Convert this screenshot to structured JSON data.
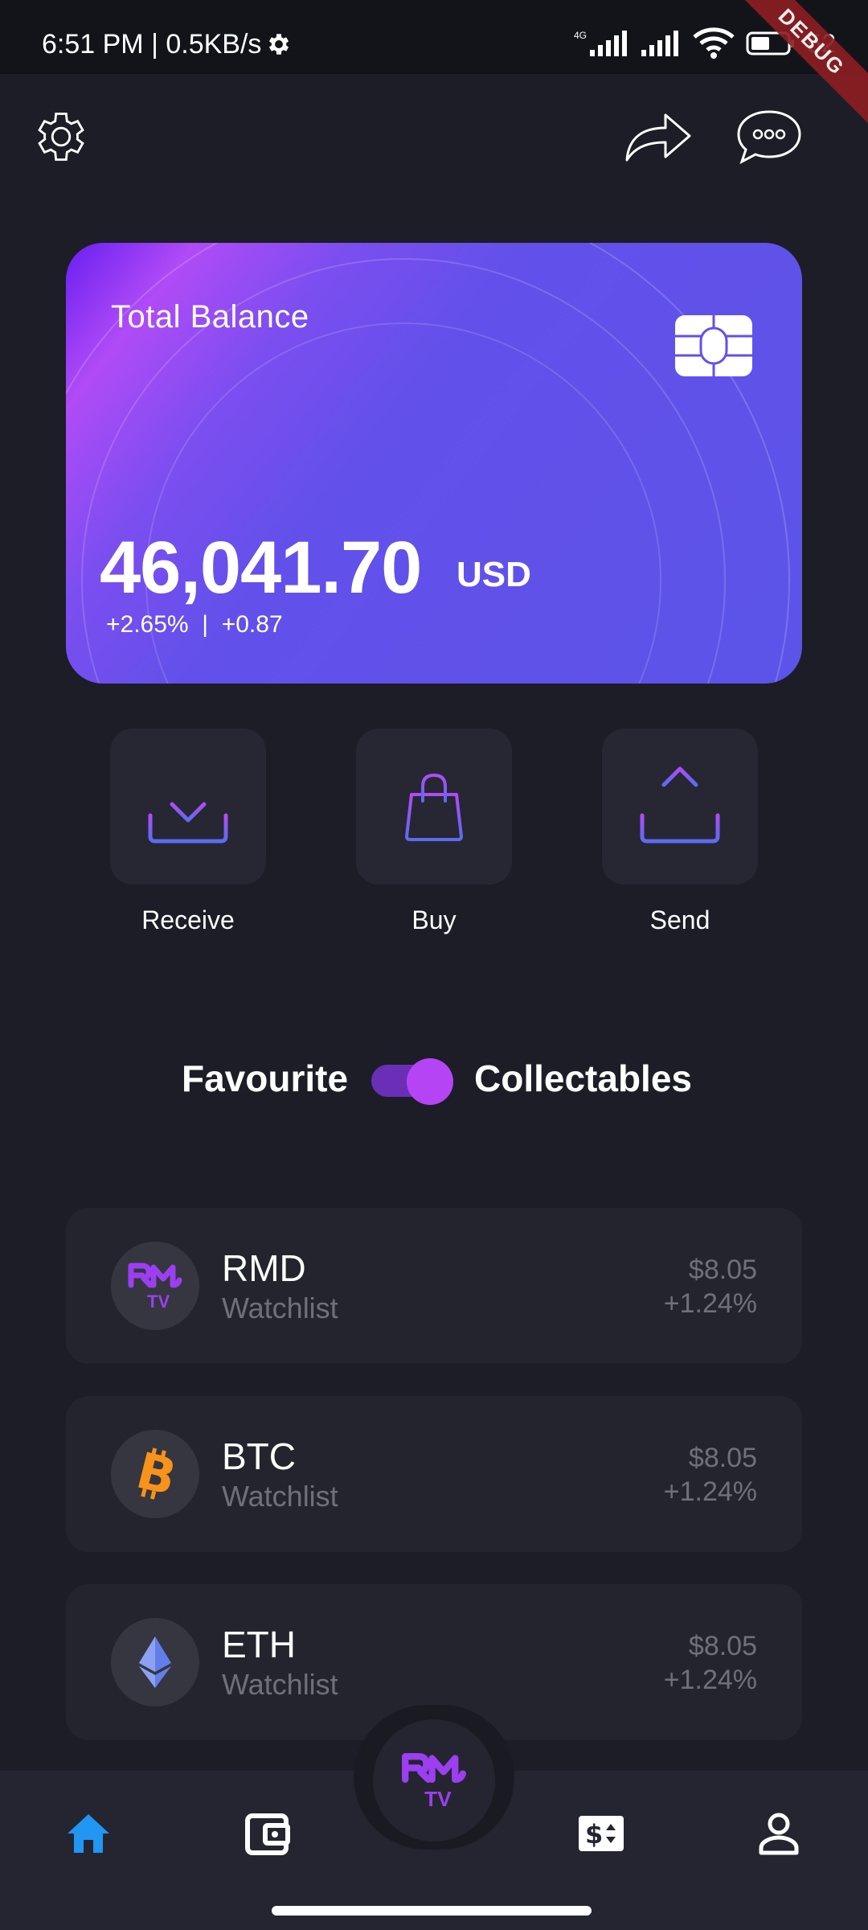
{
  "status_bar": {
    "time": "6:51 PM | 0.5KB/s",
    "network_type": "4G",
    "battery_text": "52",
    "debug_label": "DEBUG"
  },
  "top_bar": {
    "left_icon": "settings-gear-icon",
    "right_icons": [
      "share-icon",
      "chat-bubble-icon"
    ]
  },
  "balance_card": {
    "title": "Total Balance",
    "amount": "46,041.70",
    "currency": "USD",
    "change": "+2.65%  |  +0.87",
    "chip_icon": "card-chip-icon",
    "gradient_colors": [
      "#6a1ff0",
      "#b04bf7",
      "#5b54e8"
    ]
  },
  "actions": [
    {
      "label": "Receive",
      "icon": "download-icon"
    },
    {
      "label": "Buy",
      "icon": "shopping-bag-icon"
    },
    {
      "label": "Send",
      "icon": "upload-icon"
    }
  ],
  "toggle": {
    "left_label": "Favourite",
    "right_label": "Collectables",
    "state": "on",
    "accent": "#b545f4"
  },
  "coins": [
    {
      "symbol": "RMD",
      "subtitle": "Watchlist",
      "price": "$8.05",
      "change": "+1.24%",
      "logo": "rmtv-logo-icon"
    },
    {
      "symbol": "BTC",
      "subtitle": "Watchlist",
      "price": "$8.05",
      "change": "+1.24%",
      "logo": "bitcoin-icon"
    },
    {
      "symbol": "ETH",
      "subtitle": "Watchlist",
      "price": "$8.05",
      "change": "+1.24%",
      "logo": "ethereum-icon"
    }
  ],
  "bottom_nav": {
    "items": [
      "home-icon",
      "wallet-icon",
      "exchange-icon",
      "profile-icon"
    ],
    "active": "home-icon",
    "active_color": "#2196f3",
    "center_logo": "rmtv-logo-icon"
  }
}
